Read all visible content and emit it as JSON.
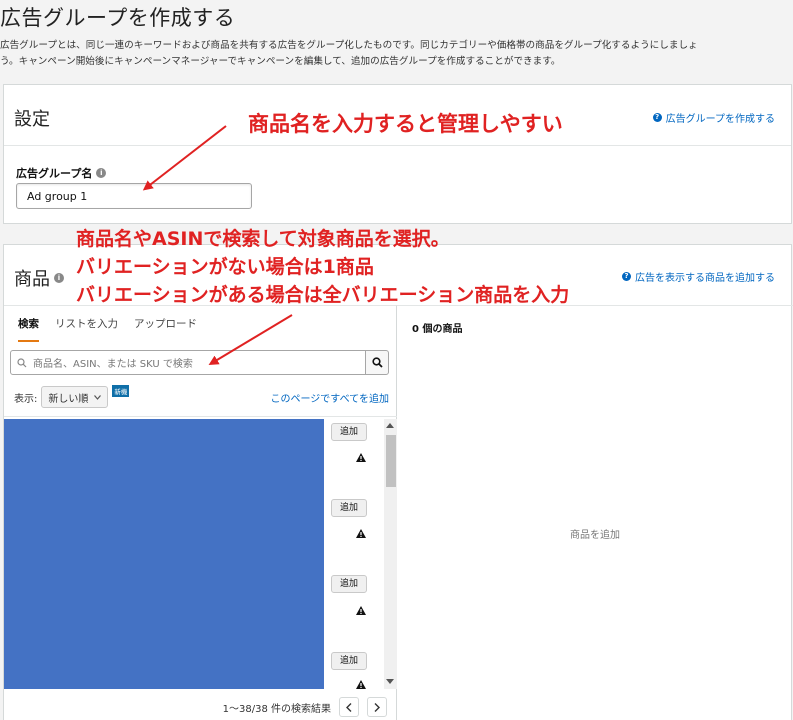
{
  "page": {
    "title": "広告グループを作成する",
    "intro_line1": "広告グループとは、同じ一連のキーワードおよび商品を共有する広告をグループ化したものです。同じカテゴリーや価格帯の商品をグループ化するようにしましょ",
    "intro_line2": "う。キャンペーン開始後にキャンペーンマネージャーでキャンペーンを編集して、追加の広告グループを作成することができます。"
  },
  "settings": {
    "title": "設定",
    "help_link": "広告グループを作成する",
    "ad_group_name_label": "広告グループ名",
    "ad_group_name_value": "Ad group 1"
  },
  "products": {
    "title": "商品",
    "help_link": "広告を表示する商品を追加する",
    "tabs": [
      {
        "label": "検索",
        "active": true
      },
      {
        "label": "リストを入力",
        "active": false
      },
      {
        "label": "アップロード",
        "active": false
      }
    ],
    "search_placeholder": "商品名、ASIN、または SKU で検索",
    "sort_label": "表示:",
    "sort_value": "新しい順",
    "new_badge": "新機",
    "add_all_link": "このページですべてを追加",
    "add_button": "追加",
    "pagination": "1〜38/38 件の検索結果",
    "selected_count": "0 個の商品",
    "empty_state": "商品を追加"
  },
  "annotations": {
    "note1": "商品名を入力すると管理しやすい",
    "note2_line1": "商品名やASINで検索して対象商品を選択。",
    "note2_line2": "バリエーションがない場合は1商品",
    "note2_line3": "バリエーションがある場合は全バリエーション商品を入力"
  },
  "colors": {
    "annotation": "#e02222",
    "link": "#0066c0",
    "tab_accent": "#e47911",
    "product_image": "#4472c4"
  }
}
